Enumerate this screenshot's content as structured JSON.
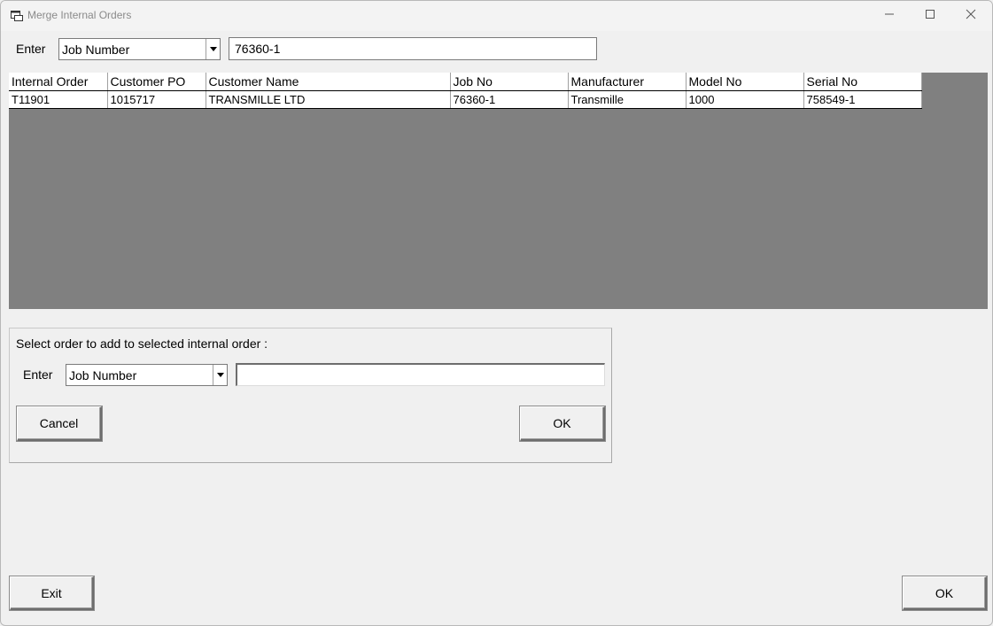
{
  "window": {
    "title": "Merge Internal Orders"
  },
  "search": {
    "label": "Enter",
    "selected_field": "Job Number",
    "value": "76360-1"
  },
  "grid": {
    "columns": [
      "Internal Order",
      "Customer PO",
      "Customer Name",
      "Job No",
      "Manufacturer",
      "Model No",
      "Serial No"
    ],
    "rows": [
      [
        "T11901",
        "1015717",
        "TRANSMILLE LTD",
        "76360-1",
        "Transmille",
        "1000",
        "758549-1"
      ]
    ]
  },
  "merge_group": {
    "caption": "Select order to add to selected internal order :",
    "label": "Enter",
    "selected_field": "Job Number",
    "value": "",
    "cancel_label": "Cancel",
    "ok_label": "OK"
  },
  "footer": {
    "exit_label": "Exit",
    "ok_label": "OK"
  },
  "colors": {
    "grid_background": "#808080",
    "window_background": "#f0f0f0"
  }
}
